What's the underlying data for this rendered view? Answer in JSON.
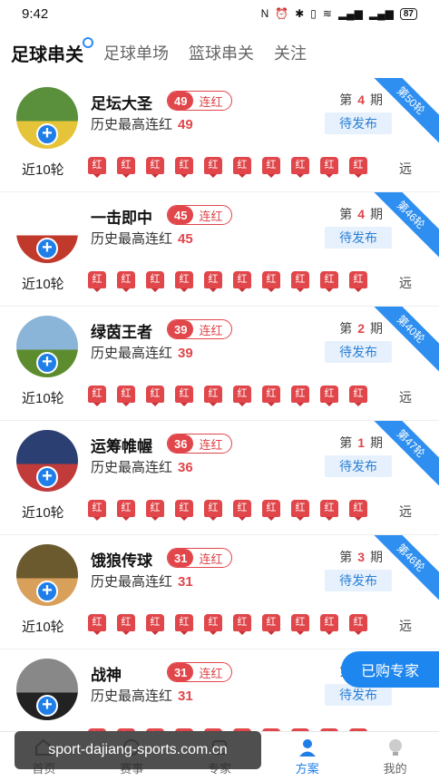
{
  "status": {
    "time": "9:42",
    "battery": "87"
  },
  "tabs": [
    "足球串关",
    "足球单场",
    "篮球串关",
    "关注"
  ],
  "labels": {
    "streak": "连红",
    "history": "历史最高连红",
    "recent": "近10轮",
    "far": "远",
    "pending": "待发布",
    "period_prefix": "第",
    "period_suffix": "期",
    "badge": "红"
  },
  "experts": [
    {
      "name": "足坛大圣",
      "streak": "49",
      "history": "49",
      "period": "4",
      "ribbon": "第50轮"
    },
    {
      "name": "一击即中",
      "streak": "45",
      "history": "45",
      "period": "4",
      "ribbon": "第46轮"
    },
    {
      "name": "绿茵王者",
      "streak": "39",
      "history": "39",
      "period": "2",
      "ribbon": "第40轮"
    },
    {
      "name": "运筹帷幄",
      "streak": "36",
      "history": "36",
      "period": "1",
      "ribbon": "第47轮"
    },
    {
      "name": "饿狼传球",
      "streak": "31",
      "history": "31",
      "period": "3",
      "ribbon": "第46轮"
    },
    {
      "name": "战神",
      "streak": "31",
      "history": "31",
      "period": "4",
      "ribbon": ""
    }
  ],
  "floating_button": "已购专家",
  "nav": [
    "首页",
    "赛事",
    "专家",
    "方案",
    "我的"
  ],
  "watermark": "sport-dajiang-sports.com.cn"
}
